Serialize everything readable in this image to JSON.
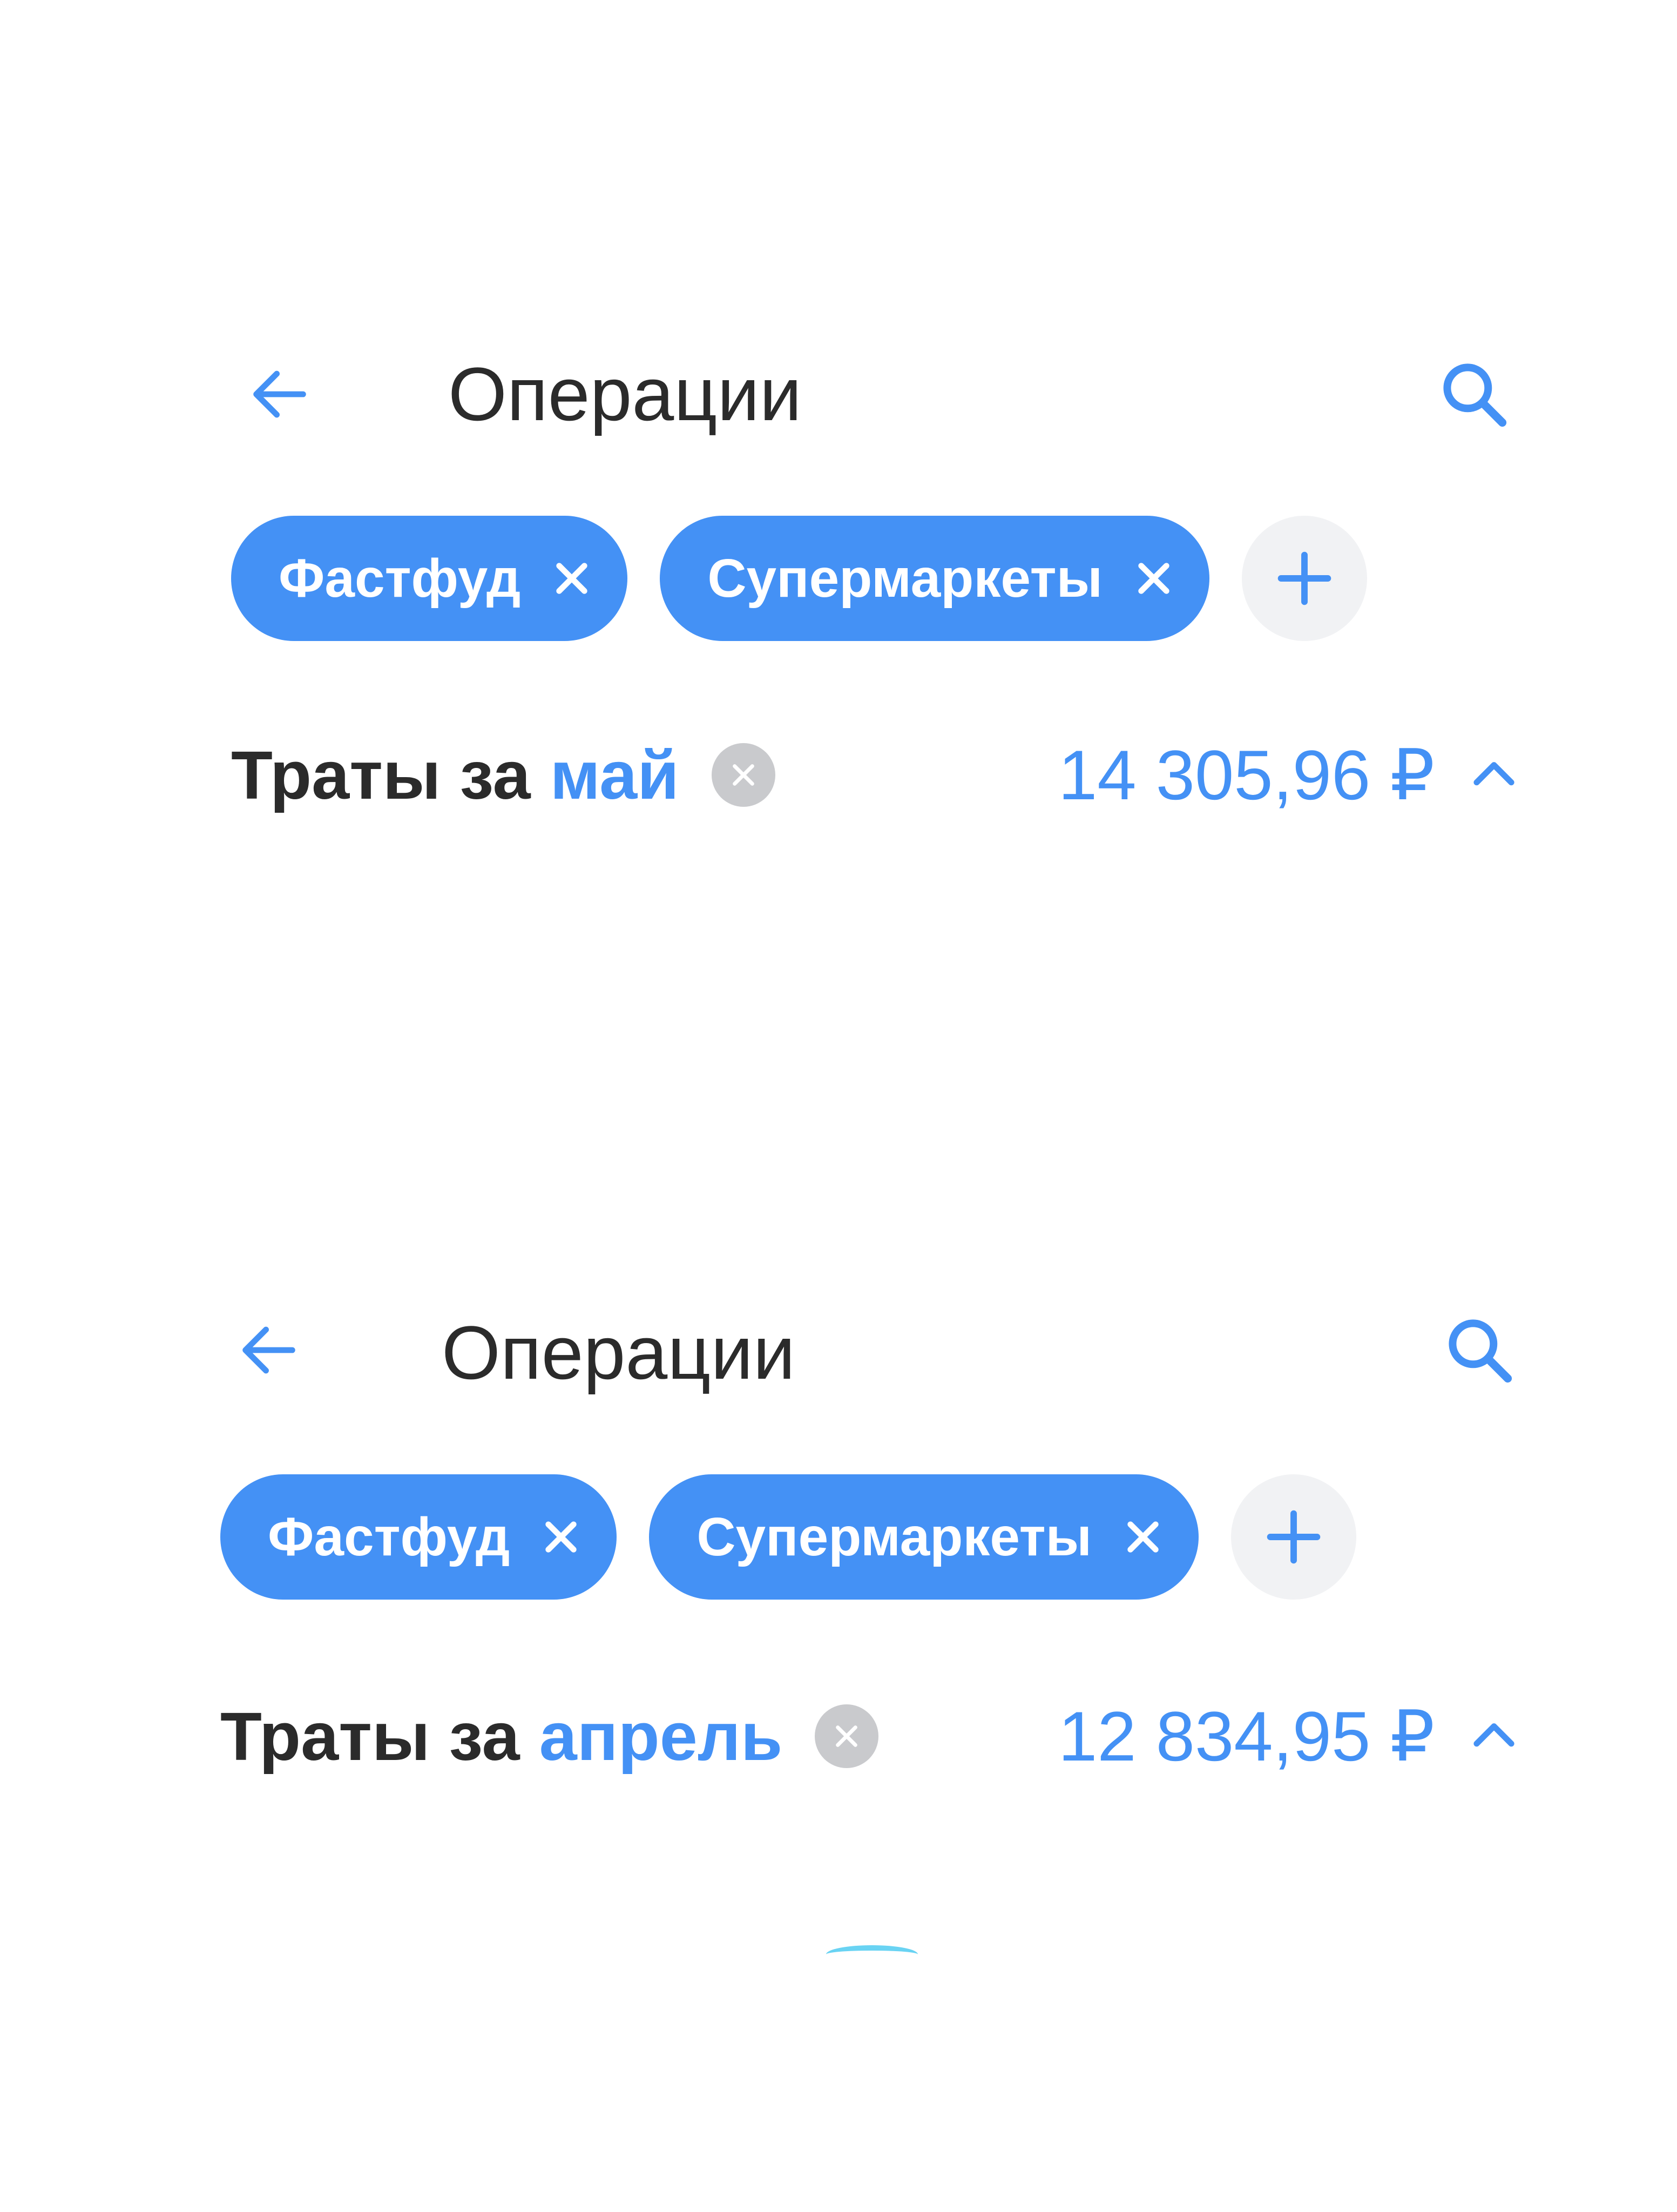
{
  "screens": [
    {
      "header": {
        "title": "Операции"
      },
      "filters": [
        {
          "label": "Фастфуд"
        },
        {
          "label": "Супермаркеты"
        }
      ],
      "summary": {
        "label": "Траты за",
        "period": "май",
        "amount": "14 305,96 ₽"
      }
    },
    {
      "header": {
        "title": "Операции"
      },
      "filters": [
        {
          "label": "Фастфуд"
        },
        {
          "label": "Супермаркеты"
        }
      ],
      "summary": {
        "label": "Траты за",
        "period": "апрель",
        "amount": "12 834,95 ₽"
      }
    }
  ],
  "colors": {
    "accent": "#4491f5",
    "text": "#2b2b2b",
    "chip_add_bg": "#f1f2f4",
    "clear_icon_bg": "#c9cacd",
    "loader": "#69d3f3"
  },
  "icons": {
    "back": "arrow-left-icon",
    "search": "search-icon",
    "chip_remove": "close-icon",
    "add_filter": "plus-icon",
    "clear_period": "clear-circle-icon",
    "collapse": "chevron-up-icon"
  }
}
